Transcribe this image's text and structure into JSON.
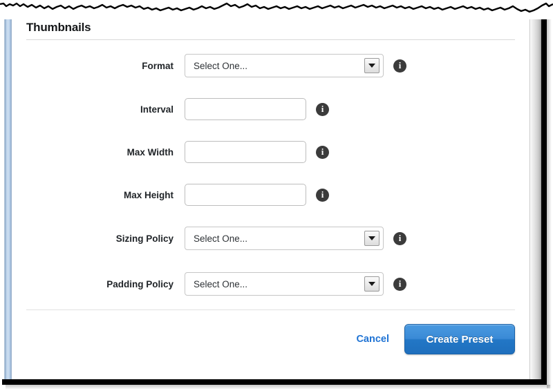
{
  "section": {
    "title": "Thumbnails"
  },
  "form": {
    "rows": [
      {
        "label": "Format",
        "control": "select",
        "value": "Select One...",
        "info": "info-icon"
      },
      {
        "label": "Interval",
        "control": "text",
        "value": "",
        "placeholder": "",
        "info": "info-icon"
      },
      {
        "label": "Max Width",
        "control": "text",
        "value": "",
        "placeholder": "",
        "info": "info-icon"
      },
      {
        "label": "Max Height",
        "control": "text",
        "value": "",
        "placeholder": "",
        "info": "info-icon"
      },
      {
        "label": "Sizing Policy",
        "control": "select",
        "value": "Select One...",
        "info": "info-icon"
      },
      {
        "label": "Padding Policy",
        "control": "select",
        "value": "Select One...",
        "info": "info-icon"
      }
    ]
  },
  "footer": {
    "cancel_label": "Cancel",
    "submit_label": "Create Preset"
  },
  "icons": {
    "info": "i",
    "select_caret": "chevron-down-icon"
  },
  "colors": {
    "accent_blue": "#2277c6",
    "link_blue": "#1f73d4",
    "info_badge": "#3b3b3b",
    "left_strip_blue": "#b6cde6",
    "rule_gray": "#d9d9d9"
  }
}
